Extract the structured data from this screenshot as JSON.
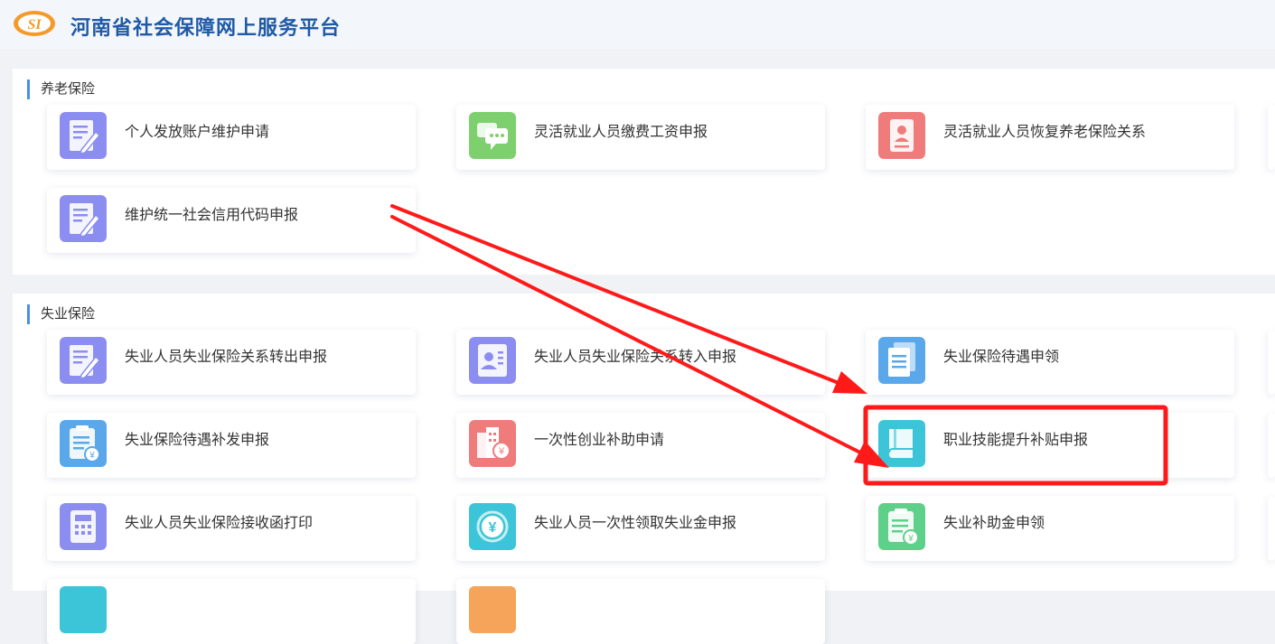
{
  "header": {
    "logo_text": "SI",
    "title": "河南省社会保障网上服务平台"
  },
  "sections": [
    {
      "title": "养老保险",
      "items": [
        {
          "label": "个人发放账户维护申请",
          "icon": "form-edit-icon",
          "color": "#8b8ef0"
        },
        {
          "label": "灵活就业人员缴费工资申报",
          "icon": "chat-icon",
          "color": "#7ed06e"
        },
        {
          "label": "灵活就业人员恢复养老保险关系",
          "icon": "id-document-icon",
          "color": "#f07b7b"
        },
        {
          "label": "维护统一社会信用代码申报",
          "icon": "form-edit-icon",
          "color": "#8b8ef0"
        }
      ]
    },
    {
      "title": "失业保险",
      "items": [
        {
          "label": "失业人员失业保险关系转出申报",
          "icon": "form-edit-icon",
          "color": "#8b8ef0"
        },
        {
          "label": "失业人员失业保险关系转入申报",
          "icon": "person-card-icon",
          "color": "#8b8ef0"
        },
        {
          "label": "失业保险待遇申领",
          "icon": "document-stack-icon",
          "color": "#5aa8ea"
        },
        {
          "label": "失业保险待遇补发申报",
          "icon": "clipboard-yen-icon",
          "color": "#5aa8ea"
        },
        {
          "label": "一次性创业补助申请",
          "icon": "building-yen-icon",
          "color": "#f07b7b"
        },
        {
          "label": "职业技能提升补贴申报",
          "icon": "book-icon",
          "color": "#3cc5d8"
        },
        {
          "label": "失业人员失业保险接收函打印",
          "icon": "calculator-icon",
          "color": "#8b8ef0"
        },
        {
          "label": "失业人员一次性领取失业金申报",
          "icon": "yen-coin-icon",
          "color": "#3cc5d8"
        },
        {
          "label": "失业补助金申领",
          "icon": "clipboard-yen-icon",
          "color": "#5ed08a"
        }
      ]
    }
  ],
  "annotation": {
    "highlight_color": "#ff1a1a",
    "highlight_target": "职业技能提升补贴申报"
  }
}
